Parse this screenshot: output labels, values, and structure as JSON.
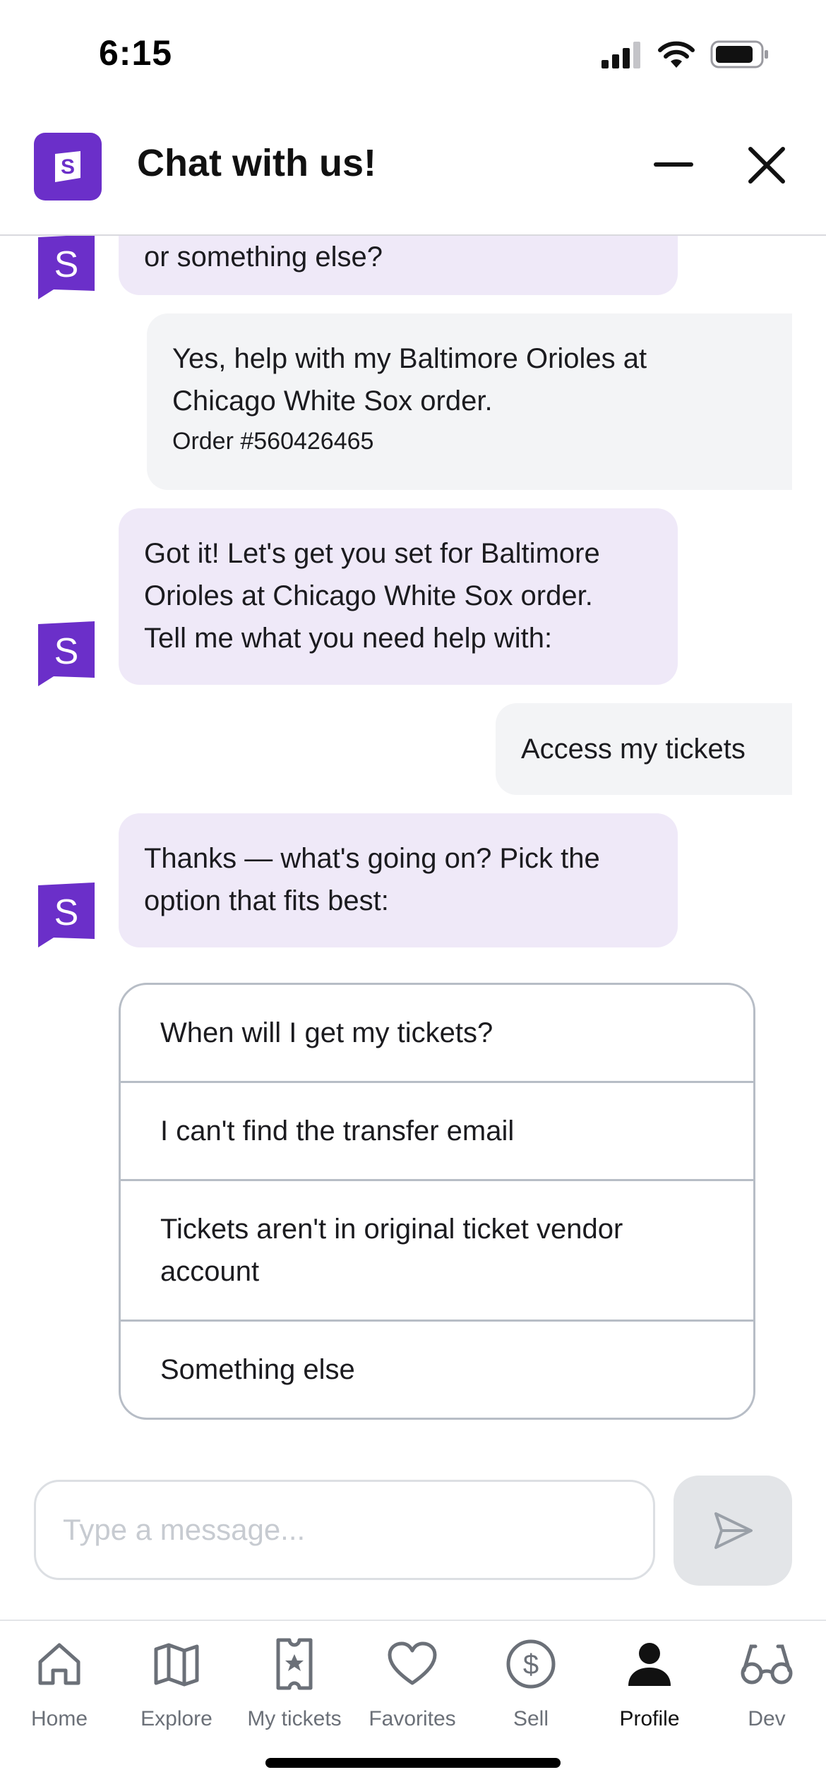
{
  "status_bar": {
    "time": "6:15"
  },
  "header": {
    "title": "Chat with us!",
    "logo_letter": "S"
  },
  "messages": [
    {
      "from": "bot",
      "text": "or something else?"
    },
    {
      "from": "user",
      "line1": "Yes, help with my Baltimore Orioles at",
      "line2": "Chicago White Sox order.",
      "sub": "Order #560426465"
    },
    {
      "from": "bot",
      "line1": "Got it! Let's get you set for Baltimore",
      "line2": "Orioles at Chicago White Sox order.",
      "line3": "Tell me what you need help with:"
    },
    {
      "from": "user",
      "text": "Access my tickets"
    },
    {
      "from": "bot",
      "line1": "Thanks — what's going on? Pick the",
      "line2": "option that fits best:"
    }
  ],
  "options": [
    "When will I get my tickets?",
    "I can't find the transfer email",
    "Tickets aren't in original ticket vendor account",
    "Something else"
  ],
  "composer": {
    "placeholder": "Type a message..."
  },
  "tabs": [
    {
      "label": "Home",
      "icon": "home-icon"
    },
    {
      "label": "Explore",
      "icon": "map-icon"
    },
    {
      "label": "My tickets",
      "icon": "ticket-icon"
    },
    {
      "label": "Favorites",
      "icon": "heart-icon"
    },
    {
      "label": "Sell",
      "icon": "dollar-icon"
    },
    {
      "label": "Profile",
      "icon": "person-icon",
      "active": true
    },
    {
      "label": "Dev",
      "icon": "glasses-icon"
    }
  ],
  "colors": {
    "brand": "#6b2fc9",
    "bot_bubble": "#efe9f8",
    "user_bubble": "#f3f4f6",
    "border": "#b7bdc6"
  }
}
